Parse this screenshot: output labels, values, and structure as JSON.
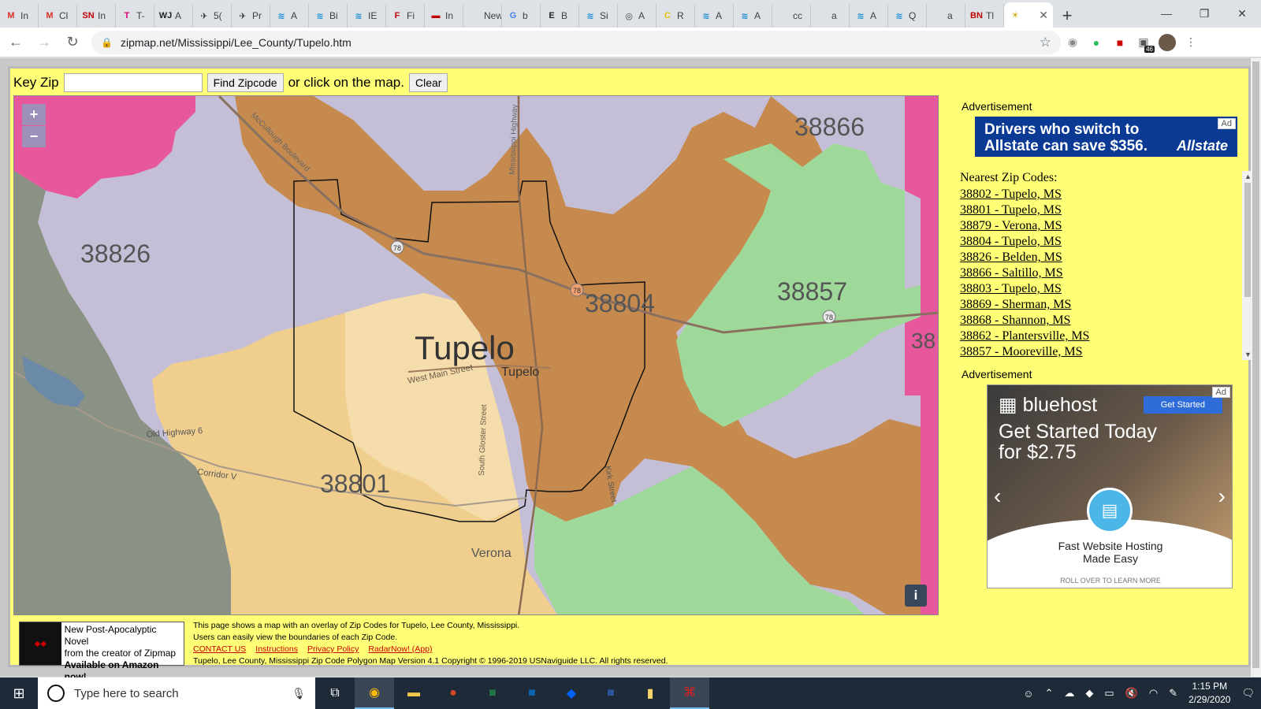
{
  "browser": {
    "tabs": [
      {
        "icon": "M",
        "color": "#d93025",
        "label": "In"
      },
      {
        "icon": "M",
        "color": "#d93025",
        "label": "Cl"
      },
      {
        "icon": "SN",
        "color": "#c00000",
        "label": "In"
      },
      {
        "icon": "T",
        "color": "#e20074",
        "label": "T-"
      },
      {
        "icon": "WJ",
        "color": "#222222",
        "label": "A"
      },
      {
        "icon": "✈",
        "color": "#333333",
        "label": "5("
      },
      {
        "icon": "✈",
        "color": "#333333",
        "label": "Pr"
      },
      {
        "icon": "≋",
        "color": "#1a8fd6",
        "label": "A"
      },
      {
        "icon": "≋",
        "color": "#1a8fd6",
        "label": "Bi"
      },
      {
        "icon": "≋",
        "color": "#1a8fd6",
        "label": "IE"
      },
      {
        "icon": "F",
        "color": "#c00000",
        "label": "Fi"
      },
      {
        "icon": "▬",
        "color": "#c00000",
        "label": "In"
      },
      {
        "icon": "",
        "color": "#555555",
        "label": "New T"
      },
      {
        "icon": "G",
        "color": "#4285f4",
        "label": "b"
      },
      {
        "icon": "E",
        "color": "#222222",
        "label": "B"
      },
      {
        "icon": "≋",
        "color": "#1a8fd6",
        "label": "Si"
      },
      {
        "icon": "◎",
        "color": "#444444",
        "label": "A"
      },
      {
        "icon": "C",
        "color": "#e6c200",
        "label": "R"
      },
      {
        "icon": "≋",
        "color": "#1a8fd6",
        "label": "A"
      },
      {
        "icon": "≋",
        "color": "#1a8fd6",
        "label": "A"
      },
      {
        "icon": "",
        "color": "#555555",
        "label": "cc"
      },
      {
        "icon": "",
        "color": "#555555",
        "label": "a"
      },
      {
        "icon": "≋",
        "color": "#1a8fd6",
        "label": "A"
      },
      {
        "icon": "≋",
        "color": "#1a8fd6",
        "label": "Q"
      },
      {
        "icon": "",
        "color": "#555555",
        "label": "a"
      },
      {
        "icon": "BN",
        "color": "#c00000",
        "label": "Tl"
      }
    ],
    "active_tab_icon": "☀",
    "url": "zipmap.net/Mississippi/Lee_County/Tupelo.htm",
    "extension_badge": "46"
  },
  "page": {
    "key_zip_label": "Key Zip",
    "key_zip_value": "",
    "find_button": "Find Zipcode",
    "or_text": "or click on the map.",
    "clear_button": "Clear",
    "map": {
      "zoom_in": "+",
      "zoom_out": "−",
      "info_button": "i",
      "labels": {
        "zip_38866": "38866",
        "zip_38826": "38826",
        "zip_38857": "38857",
        "zip_38804": "38804",
        "zip_38801": "38801",
        "zip_38_partial": "38",
        "city_tupelo": "Tupelo",
        "city_tupelo_small": "Tupelo",
        "city_verona": "Verona",
        "road_west_main": "West Main Street",
        "road_old_highway": "Old Highway 6",
        "road_corridor": "Corridor V",
        "road_south_gloster": "South Gloster Street",
        "road_kirk": "Kirk Street",
        "road_mississippi": "Mississippi Highway",
        "road_mccullough": "McCullough Boulevard",
        "shield_78a": "78",
        "shield_78b": "78",
        "shield_78c": "78"
      }
    },
    "ad1": {
      "label": "Advertisement",
      "chip": "Ad",
      "text": "Drivers who switch to Allstate can save $356.",
      "brand": "Allstate"
    },
    "nearest": {
      "heading": "Nearest Zip Codes:",
      "items": [
        "38802 - Tupelo, MS",
        "38801 - Tupelo, MS",
        "38879 - Verona, MS",
        "38804 - Tupelo, MS",
        "38826 - Belden, MS",
        "38866 - Saltillo, MS",
        "38803 - Tupelo, MS",
        "38869 - Sherman, MS",
        "38868 - Shannon, MS",
        "38862 - Plantersville, MS",
        "38857 - Mooreville, MS"
      ]
    },
    "ad2": {
      "label": "Advertisement",
      "chip": "Ad",
      "brand": "bluehost",
      "cta": "Get Started",
      "headline": "Get Started Today for $2.75",
      "sub1": "Fast Website Hosting",
      "sub2": "Made Easy",
      "roll": "ROLL OVER TO LEARN MORE"
    },
    "novel": {
      "line1": "New Post-Apocalyptic Novel",
      "line2": "from the creator of Zipmap",
      "line3": "Available on Amazon now!"
    },
    "footer": {
      "desc1": "This page shows a map with an overlay of Zip Codes for Tupelo, Lee County, Mississippi.",
      "desc2": "Users can easily view the boundaries of each Zip Code.",
      "links": [
        "CONTACT US",
        "Instructions",
        "Privacy Policy",
        "RadarNow! (App)"
      ],
      "version": "Tupelo, Lee County, Mississippi Zip Code Polygon Map Version 4.1    Copyright © 1996-2019 USNaviguide LLC. All rights reserved."
    }
  },
  "taskbar": {
    "search_placeholder": "Type here to search",
    "time": "1:15 PM",
    "date": "2/29/2020"
  },
  "colors": {
    "page_bg": "#ffff77",
    "zip_orange": "#c68a4e",
    "zip_tan": "#f0cf8e",
    "zip_green": "#9fd99a",
    "zip_lavender": "#c4bfd6",
    "zip_pink": "#e7579c",
    "zip_gray": "#8a9185"
  }
}
